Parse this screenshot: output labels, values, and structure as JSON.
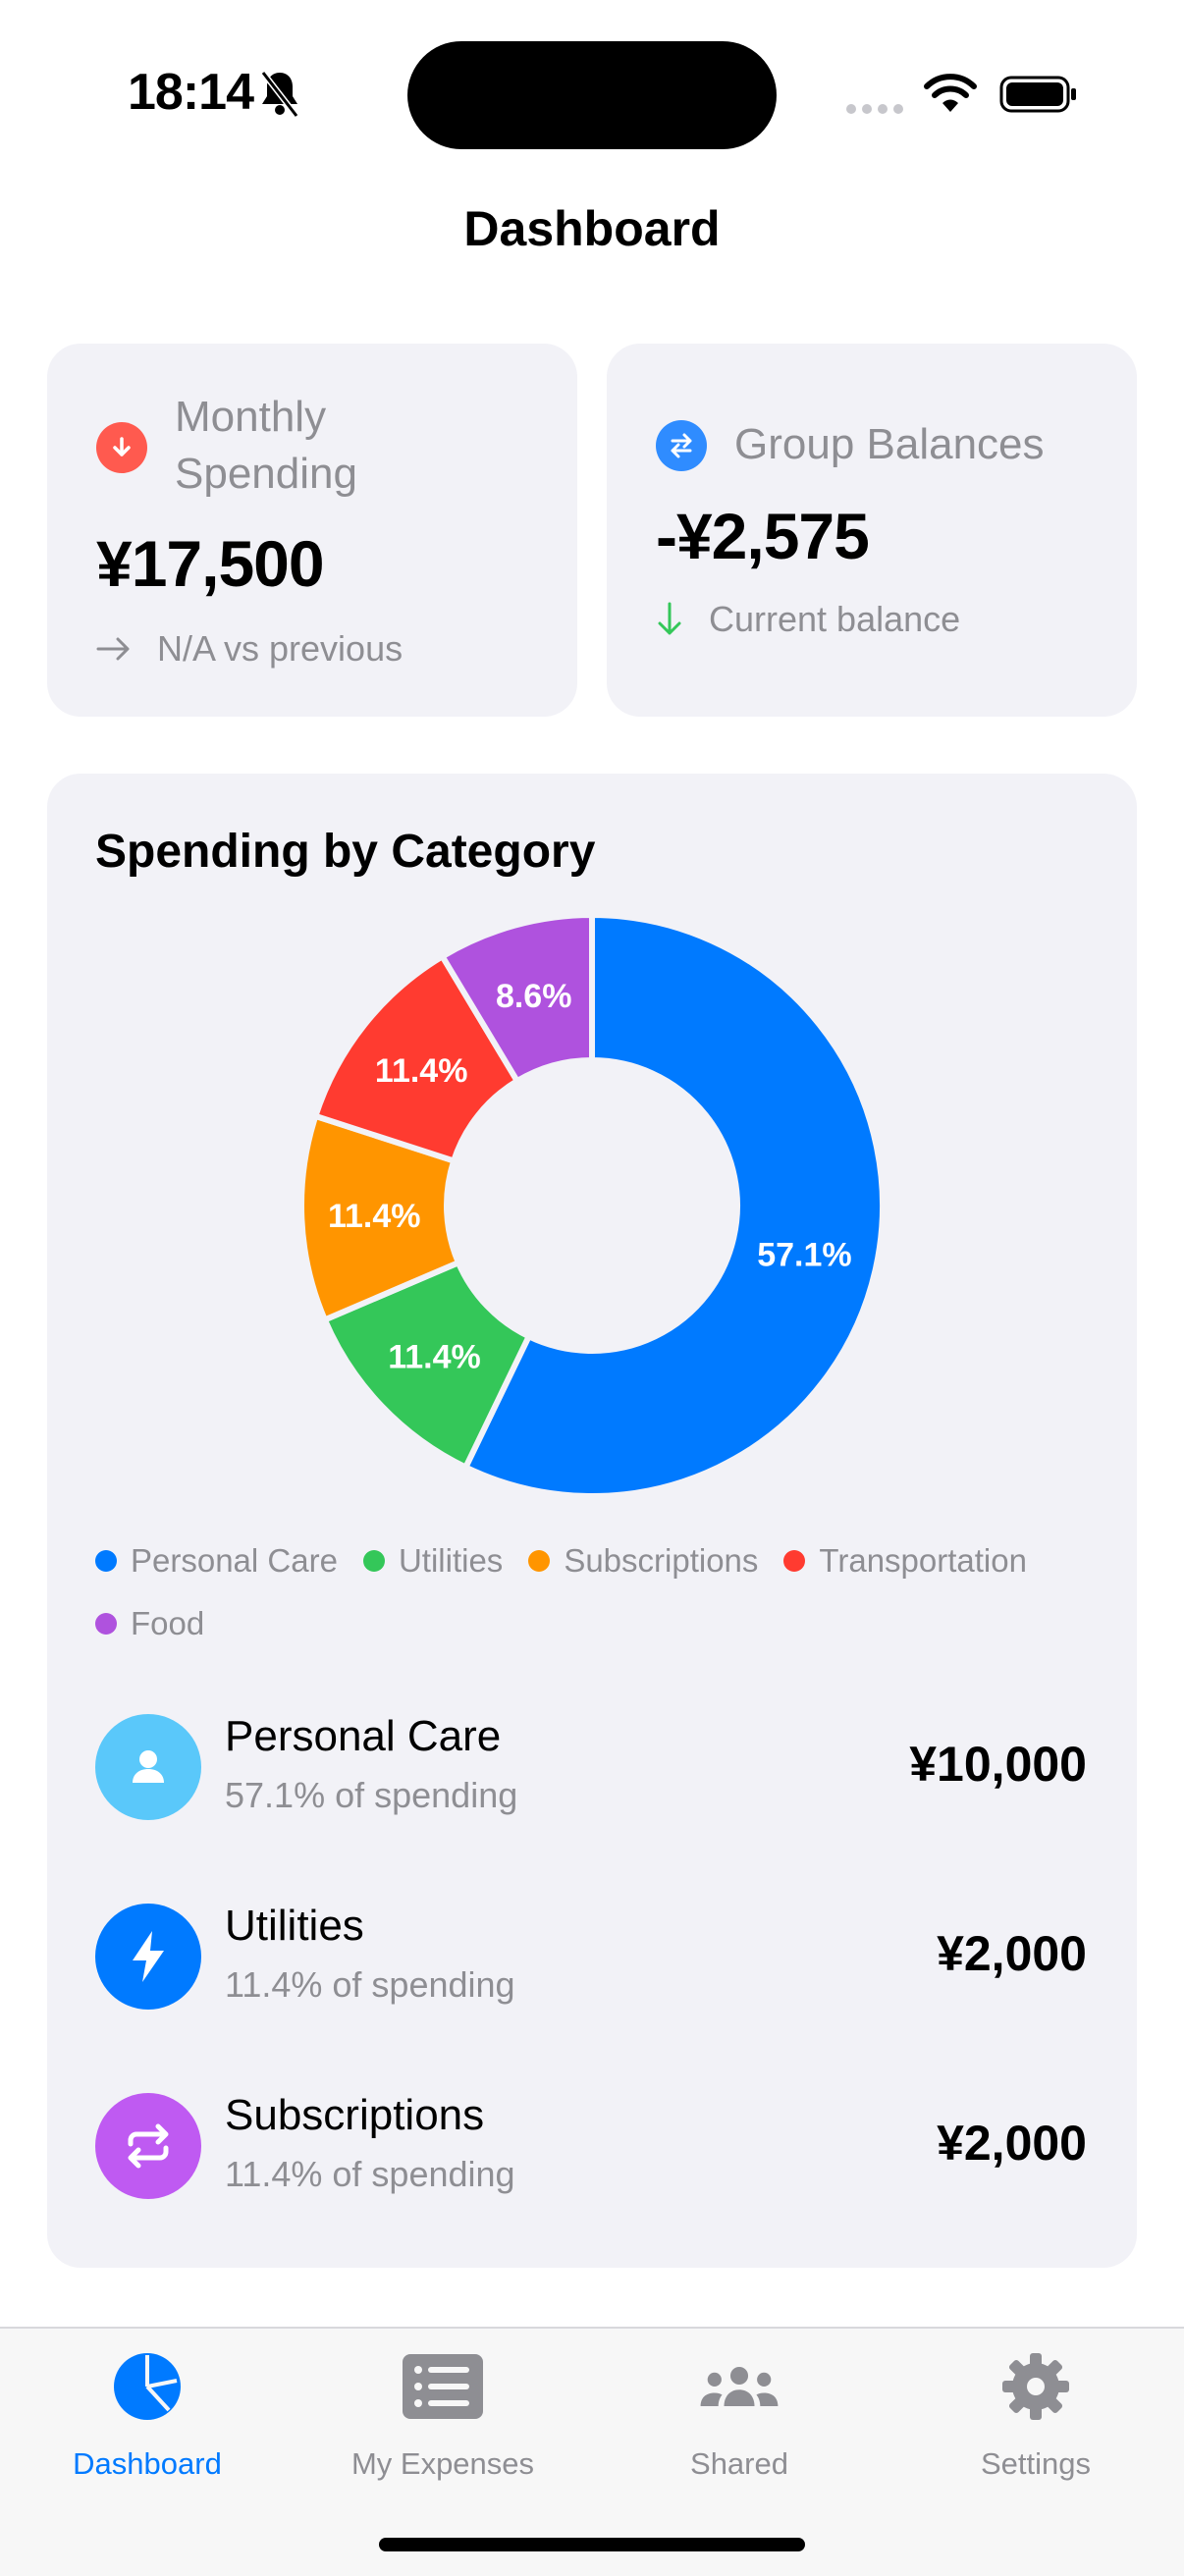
{
  "status_bar": {
    "time": "18:14"
  },
  "page": {
    "title": "Dashboard"
  },
  "monthly_spending": {
    "label_line1": "Monthly",
    "label_line2": "Spending",
    "value": "¥17,500",
    "comparison": "N/A vs previous",
    "icon": "arrow-down-circle-icon",
    "icon_color": "#ff5a4f"
  },
  "group_balances": {
    "label": "Group Balances",
    "value": "-¥2,575",
    "subtitle": "Current balance",
    "icon": "arrows-exchange-icon",
    "icon_color": "#2f8cff",
    "trend_color": "#34c759"
  },
  "spending_by_category": {
    "title": "Spending by Category",
    "legend": [
      {
        "label": "Personal Care",
        "color": "#007aff"
      },
      {
        "label": "Utilities",
        "color": "#34c759"
      },
      {
        "label": "Subscriptions",
        "color": "#ff9500"
      },
      {
        "label": "Transportation",
        "color": "#ff3b30"
      },
      {
        "label": "Food",
        "color": "#af52de"
      }
    ],
    "rows": [
      {
        "name": "Personal Care",
        "percent_text": "57.1% of spending",
        "amount": "¥10,000",
        "icon": "person-icon",
        "color": "#5ac8fa"
      },
      {
        "name": "Utilities",
        "percent_text": "11.4% of spending",
        "amount": "¥2,000",
        "icon": "bolt-icon",
        "color": "#007aff"
      },
      {
        "name": "Subscriptions",
        "percent_text": "11.4% of spending",
        "amount": "¥2,000",
        "icon": "repeat-icon",
        "color": "#bf5af2"
      }
    ]
  },
  "chart_data": {
    "type": "pie",
    "categories": [
      "Personal Care",
      "Utilities",
      "Subscriptions",
      "Transportation",
      "Food"
    ],
    "values": [
      57.1,
      11.4,
      11.4,
      11.4,
      8.6
    ],
    "labels": [
      "57.1%",
      "11.4%",
      "11.4%",
      "11.4%",
      "8.6%"
    ],
    "colors": [
      "#007aff",
      "#34c759",
      "#ff9500",
      "#ff3b30",
      "#af52de"
    ],
    "legend_position": "bottom"
  },
  "tabbar": {
    "tabs": [
      {
        "label": "Dashboard",
        "icon": "pie-chart-icon",
        "active": true
      },
      {
        "label": "My Expenses",
        "icon": "list-icon",
        "active": false
      },
      {
        "label": "Shared",
        "icon": "people-icon",
        "active": false
      },
      {
        "label": "Settings",
        "icon": "gear-icon",
        "active": false
      }
    ],
    "active_color": "#007aff",
    "inactive_color": "#8e8e93"
  }
}
